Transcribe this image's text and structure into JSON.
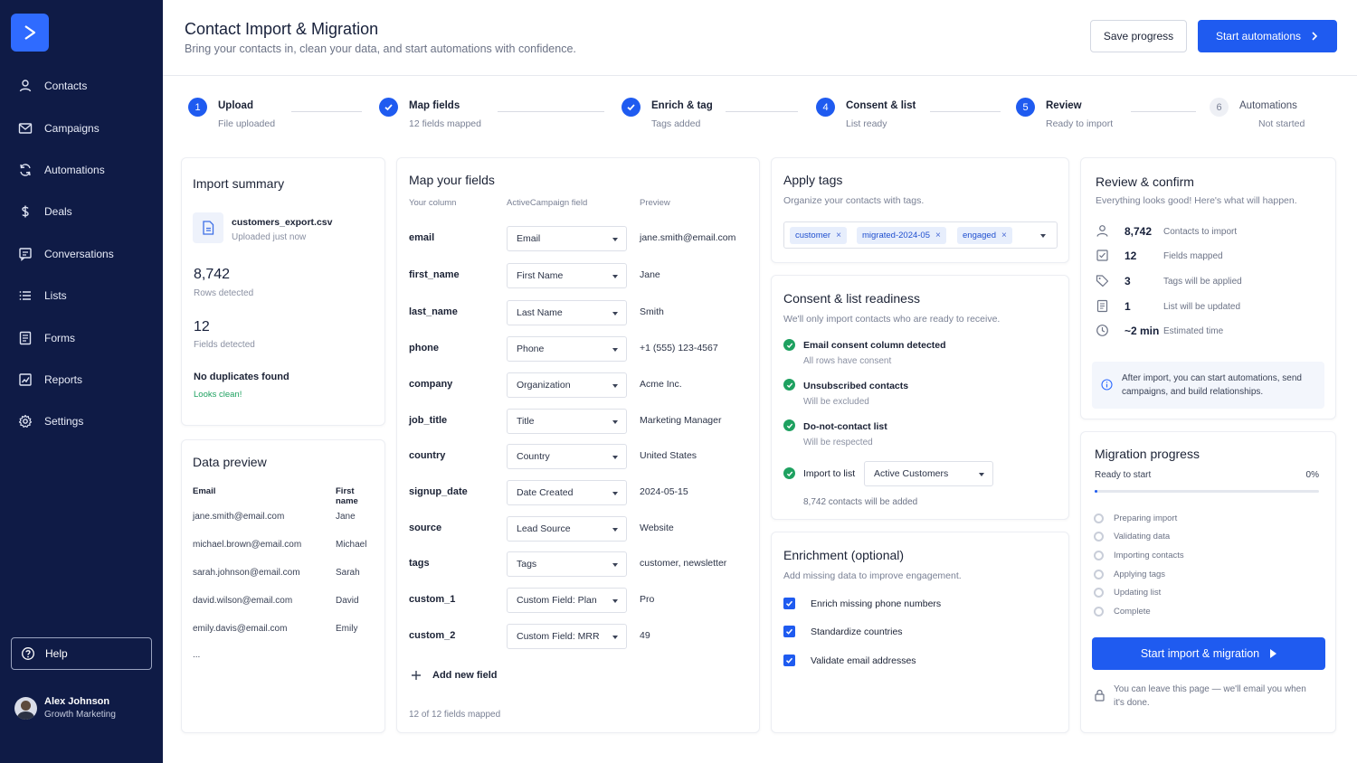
{
  "sidebar": {
    "items": [
      {
        "label": "Contacts",
        "icon": "user-icon"
      },
      {
        "label": "Campaigns",
        "icon": "mail-icon"
      },
      {
        "label": "Automations",
        "icon": "refresh-icon"
      },
      {
        "label": "Deals",
        "icon": "dollar-icon"
      },
      {
        "label": "Conversations",
        "icon": "chat-icon"
      },
      {
        "label": "Lists",
        "icon": "list-icon"
      },
      {
        "label": "Forms",
        "icon": "form-icon"
      },
      {
        "label": "Reports",
        "icon": "chart-icon"
      },
      {
        "label": "Settings",
        "icon": "gear-icon"
      }
    ],
    "help_label": "Help",
    "user": {
      "name": "Alex Johnson",
      "role": "Growth Marketing"
    }
  },
  "header": {
    "title": "Contact Import & Migration",
    "subtitle": "Bring your contacts in, clean your data, and start automations with confidence.",
    "save_label": "Save progress",
    "start_label": "Start automations"
  },
  "steps": [
    {
      "num": "1",
      "label": "Upload",
      "sub": "File uploaded",
      "state": "active"
    },
    {
      "num": "",
      "label": "Map fields",
      "sub": "12 fields mapped",
      "state": "done"
    },
    {
      "num": "",
      "label": "Enrich & tag",
      "sub": "Tags added",
      "state": "done"
    },
    {
      "num": "4",
      "label": "Consent & list",
      "sub": "List ready",
      "state": "active"
    },
    {
      "num": "5",
      "label": "Review",
      "sub": "Ready to import",
      "state": "active"
    },
    {
      "num": "6",
      "label": "Automations",
      "sub": "Not started",
      "state": "pending"
    }
  ],
  "import_summary": {
    "title": "Import summary",
    "file_name": "customers_export.csv",
    "file_status": "Uploaded just now",
    "rows_value": "8,742",
    "rows_label": "Rows detected",
    "fields_value": "12",
    "fields_label": "Fields detected",
    "dup_title": "No duplicates found",
    "dup_sub": "Looks clean!"
  },
  "data_preview": {
    "title": "Data preview",
    "headers": [
      "Email",
      "First name"
    ],
    "rows": [
      [
        "jane.smith@email.com",
        "Jane"
      ],
      [
        "michael.brown@email.com",
        "Michael"
      ],
      [
        "sarah.johnson@email.com",
        "Sarah"
      ],
      [
        "david.wilson@email.com",
        "David"
      ],
      [
        "emily.davis@email.com",
        "Emily"
      ]
    ],
    "more": "..."
  },
  "map_fields": {
    "title": "Map your fields",
    "headers": [
      "Your column",
      "ActiveCampaign field",
      "Preview"
    ],
    "rows": [
      {
        "column": "email",
        "field": "Email",
        "preview": "jane.smith@email.com"
      },
      {
        "column": "first_name",
        "field": "First Name",
        "preview": "Jane"
      },
      {
        "column": "last_name",
        "field": "Last Name",
        "preview": "Smith"
      },
      {
        "column": "phone",
        "field": "Phone",
        "preview": "+1 (555) 123-4567"
      },
      {
        "column": "company",
        "field": "Organization",
        "preview": "Acme Inc."
      },
      {
        "column": "job_title",
        "field": "Title",
        "preview": "Marketing Manager"
      },
      {
        "column": "country",
        "field": "Country",
        "preview": "United States"
      },
      {
        "column": "signup_date",
        "field": "Date Created",
        "preview": "2024-05-15"
      },
      {
        "column": "source",
        "field": "Lead Source",
        "preview": "Website"
      },
      {
        "column": "tags",
        "field": "Tags",
        "preview": "customer, newsletter"
      },
      {
        "column": "custom_1",
        "field": "Custom Field: Plan",
        "preview": "Pro"
      },
      {
        "column": "custom_2",
        "field": "Custom Field: MRR",
        "preview": "49"
      }
    ],
    "add_label": "Add new field",
    "footer": "12 of 12 fields mapped"
  },
  "apply_tags": {
    "title": "Apply tags",
    "desc": "Organize your contacts with tags.",
    "tags": [
      "customer",
      "migrated-2024-05",
      "engaged"
    ]
  },
  "consent": {
    "title": "Consent & list readiness",
    "desc": "We'll only import contacts who are ready to receive.",
    "checks": [
      {
        "label": "Email consent column detected",
        "sub": "All rows have consent"
      },
      {
        "label": "Unsubscribed contacts",
        "sub": "Will be excluded"
      },
      {
        "label": "Do-not-contact list",
        "sub": "Will be respected"
      }
    ],
    "list_label": "Import to list",
    "list_value": "Active Customers",
    "list_note": "8,742 contacts will be added"
  },
  "enrichment": {
    "title": "Enrichment (optional)",
    "desc": "Add missing data to improve engagement.",
    "options": [
      {
        "label": "Enrich missing phone numbers",
        "checked": true
      },
      {
        "label": "Standardize countries",
        "checked": true
      },
      {
        "label": "Validate email addresses",
        "checked": true
      }
    ]
  },
  "review": {
    "title": "Review & confirm",
    "desc": "Everything looks good! Here's what will happen.",
    "rows": [
      {
        "value": "8,742",
        "label": "Contacts to import",
        "icon": "person-icon"
      },
      {
        "value": "12",
        "label": "Fields mapped",
        "icon": "checklist-icon"
      },
      {
        "value": "3",
        "label": "Tags will be applied",
        "icon": "tag-icon"
      },
      {
        "value": "1",
        "label": "List will be updated",
        "icon": "document-icon"
      },
      {
        "value": "~2 min",
        "label": "Estimated time",
        "icon": "clock-icon"
      }
    ],
    "info": "After import, you can start automations, send campaigns, and build relationships."
  },
  "migration": {
    "title": "Migration progress",
    "status": "Ready to start",
    "percent": "0%",
    "progress_fraction": 0,
    "steps": [
      "Preparing import",
      "Validating data",
      "Importing contacts",
      "Applying tags",
      "Updating list",
      "Complete"
    ],
    "button_label": "Start import & migration",
    "note": "You can leave this page — we'll email you when it's done."
  },
  "colors": {
    "sidebar_bg": "#0f1b46",
    "primary": "#1f5bf0",
    "success": "#1ea160"
  }
}
